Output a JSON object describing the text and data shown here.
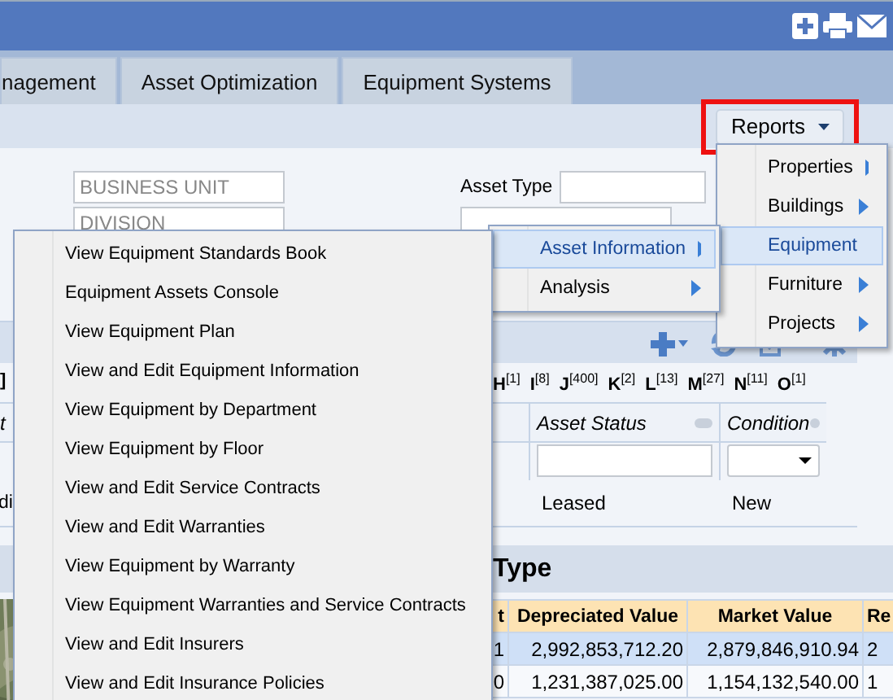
{
  "tabs": [
    {
      "label": "nagement",
      "selected": false
    },
    {
      "label": "Asset Optimization",
      "selected": false
    },
    {
      "label": "Equipment Systems",
      "selected": false
    }
  ],
  "reports_button": {
    "label": "Reports",
    "highlighted": true
  },
  "filters": {
    "business_unit": {
      "placeholder": "BUSINESS UNIT"
    },
    "division": {
      "placeholder": "DIVISION"
    },
    "asset_type": {
      "label": "Asset Type"
    }
  },
  "index_fragment": "]",
  "alpha_index": [
    {
      "letter": "H",
      "count": "[1]"
    },
    {
      "letter": "I",
      "count": "[8]"
    },
    {
      "letter": "J",
      "count": "[400]"
    },
    {
      "letter": "K",
      "count": "[2]"
    },
    {
      "letter": "L",
      "count": "[13]"
    },
    {
      "letter": "M",
      "count": "[27]"
    },
    {
      "letter": "N",
      "count": "[11]"
    },
    {
      "letter": "O",
      "count": "[1]"
    }
  ],
  "grid": {
    "columns": [
      {
        "label": "t",
        "kind": "none"
      },
      {
        "label": "Asset Status",
        "kind": "text"
      },
      {
        "label": "Condition",
        "kind": "select"
      }
    ],
    "rows": [
      [
        "di",
        "Leased",
        "New"
      ]
    ]
  },
  "summary": {
    "title": "Type",
    "columns": [
      "t",
      "Depreciated Value",
      "Market Value",
      "Re"
    ],
    "rows": [
      {
        "selected": true,
        "cells": [
          "1",
          "2,992,853,712.20",
          "2,879,846,910.94",
          "2"
        ]
      },
      {
        "selected": false,
        "cells": [
          "0",
          "1,231,387,025.00",
          "1,154,132,540.00",
          "1"
        ]
      }
    ]
  },
  "reports_menu": [
    {
      "label": "Properties",
      "selected": false
    },
    {
      "label": "Buildings",
      "selected": false
    },
    {
      "label": "Equipment",
      "selected": true
    },
    {
      "label": "Furniture",
      "selected": false
    },
    {
      "label": "Projects",
      "selected": false
    }
  ],
  "equipment_menu": [
    {
      "label": "Asset Information",
      "selected": true
    },
    {
      "label": "Analysis",
      "selected": false
    }
  ],
  "asset_information_menu": [
    {
      "label": "View Equipment Standards Book",
      "selected": false
    },
    {
      "label": "Equipment Assets Console",
      "selected": false
    },
    {
      "label": "View Equipment Plan",
      "selected": false
    },
    {
      "label": "View and Edit Equipment Information",
      "selected": false
    },
    {
      "label": "View Equipment by Department",
      "selected": false
    },
    {
      "label": "View Equipment by Floor",
      "selected": false
    },
    {
      "label": "View and Edit Service Contracts",
      "selected": false
    },
    {
      "label": "View and Edit Warranties",
      "selected": false
    },
    {
      "label": "View Equipment by Warranty",
      "selected": false
    },
    {
      "label": "View Equipment Warranties and Service Contracts",
      "selected": false
    },
    {
      "label": "View and Edit Insurers",
      "selected": false
    },
    {
      "label": "View and Edit Insurance Policies",
      "selected": false
    }
  ]
}
